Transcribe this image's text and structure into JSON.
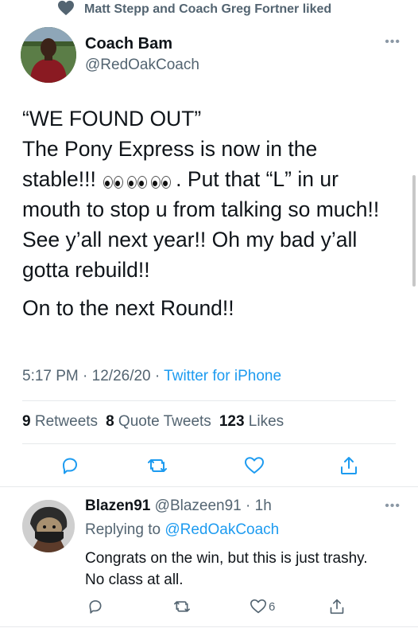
{
  "social_context": {
    "text": "Matt Stepp and Coach Greg Fortner liked",
    "icon": "heart-icon"
  },
  "tweet": {
    "author_name": "Coach Bam",
    "author_handle": "@RedOakCoach",
    "text_line1": "“WE FOUND OUT”",
    "text_line2": " The Pony Express is now in the",
    "text_line3a": "stable!!! ",
    "text_line3b": ". Put that “L” in ur",
    "text_line4": "mouth to stop u from talking so much!!",
    "text_line5": "See y’all next year!! Oh my bad y’all",
    "text_line6": "gotta rebuild!!",
    "text_line7": "On to the next Round!!",
    "emoji": "eyes-emoji x3",
    "time": "5:17 PM",
    "date": "12/26/20",
    "source": "Twitter for iPhone",
    "retweets_count": "9",
    "retweets_label": "Retweets",
    "quotes_count": "8",
    "quotes_label": "Quote Tweets",
    "likes_count": "123",
    "likes_label": "Likes"
  },
  "reply": {
    "author_name": "Blazen91",
    "author_handle": "@Blazeen91",
    "time_ago": "1h",
    "replying_to_label": "Replying to",
    "replying_to_handle": "@RedOakCoach",
    "text_line1": "Congrats on the win, but this is just trashy.",
    "text_line2": "No class at all.",
    "likes_count": "6"
  },
  "colors": {
    "accent": "#1d9bf0",
    "secondary_text": "#536471",
    "divider": "#e6e9eb"
  }
}
